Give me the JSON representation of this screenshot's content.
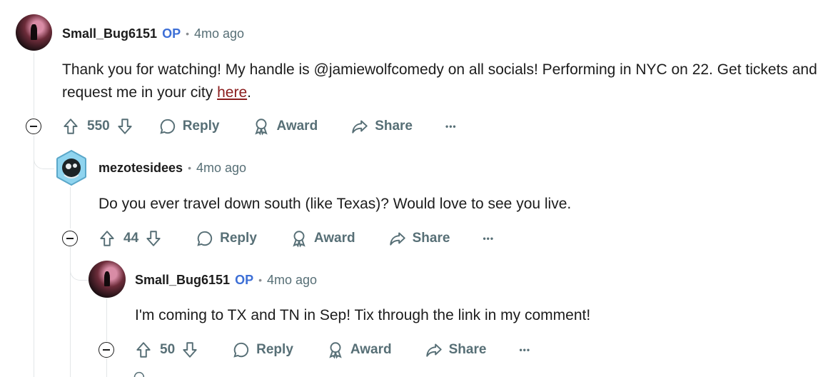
{
  "comments": [
    {
      "author": "Small_Bug6151",
      "op_tag": "OP",
      "separator": "•",
      "time": "4mo ago",
      "body_before_link": "Thank you for watching! My handle is @jamiewolfcomedy on all socials! Performing in NYC on 22. Get tickets and request me in your city ",
      "link_text": "here",
      "body_after_link": ".",
      "votes": "550"
    },
    {
      "author": "mezotesidees",
      "separator": "•",
      "time": "4mo ago",
      "body": "Do you ever travel down south (like Texas)? Would love to see you live.",
      "votes": "44"
    },
    {
      "author": "Small_Bug6151",
      "op_tag": "OP",
      "separator": "•",
      "time": "4mo ago",
      "body": "I'm coming to TX and TN in Sep! Tix through the link in my comment!",
      "votes": "50"
    }
  ],
  "actions": {
    "reply": "Reply",
    "award": "Award",
    "share": "Share",
    "more": "•••"
  },
  "icons": {
    "upvote": "arrow-up-icon",
    "downvote": "arrow-down-icon",
    "reply": "speech-bubble-icon",
    "award": "award-ribbon-icon",
    "share": "share-arrow-icon",
    "collapse": "minus-circle-icon"
  },
  "colors": {
    "op_tag": "#3d6fd6",
    "link": "#8a1c1c",
    "muted": "#576f76",
    "thread_line": "#e3e6e8"
  }
}
